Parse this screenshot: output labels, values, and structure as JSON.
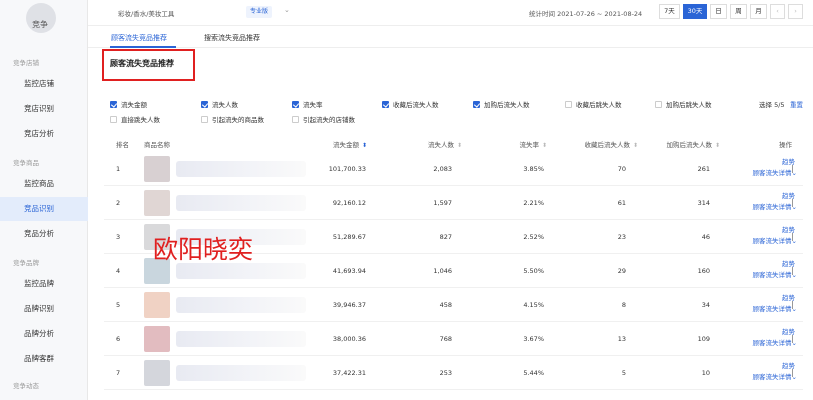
{
  "sidebar": {
    "logo_text": "竞争",
    "groups": [
      {
        "label": "竞争店铺",
        "items": [
          "监控店铺",
          "竞店识别",
          "竞店分析"
        ]
      },
      {
        "label": "竞争商品",
        "items": [
          "监控商品",
          "竞品识别",
          "竞品分析"
        ]
      },
      {
        "label": "竞争品牌",
        "items": [
          "监控品牌",
          "品牌识别",
          "品牌分析",
          "品牌客群"
        ]
      },
      {
        "label": "竞争动态",
        "items": []
      }
    ],
    "active_item": "竞品识别"
  },
  "topbar": {
    "breadcrumb": "彩妆/香水/美妆工具",
    "badge": "专业版",
    "stat_time": "统计时间 2021-07-26 ~ 2021-08-24",
    "range_buttons": [
      "7天",
      "30天",
      "日",
      "周",
      "月"
    ],
    "active_range": "30天"
  },
  "tabs": [
    "顾客流失竞品推荐",
    "搜索流失竞品推荐"
  ],
  "active_tab": "顾客流失竞品推荐",
  "section_title": "顾客流失竞品推荐",
  "filters": [
    {
      "label": "流失金额",
      "checked": true
    },
    {
      "label": "流失人数",
      "checked": true
    },
    {
      "label": "流失率",
      "checked": true
    },
    {
      "label": "收藏后流失人数",
      "checked": true
    },
    {
      "label": "加购后流失人数",
      "checked": true
    },
    {
      "label": "收藏后跳失人数",
      "checked": false
    },
    {
      "label": "加购后跳失人数",
      "checked": false
    },
    {
      "label": "直接跳失人数",
      "checked": false
    },
    {
      "label": "引起流失的商品数",
      "checked": false
    },
    {
      "label": "引起流失的店铺数",
      "checked": false
    }
  ],
  "selection": {
    "count_text": "选择 5/5",
    "reset_label": "重置"
  },
  "table": {
    "headers": [
      "排名",
      "商品名称",
      "流失金额",
      "流失人数",
      "流失率",
      "收藏后流失人数",
      "加购后流失人数",
      "操作"
    ],
    "op_trend": "趋势",
    "op_detail": "顾客流失详情",
    "rows": [
      {
        "rank": "1",
        "amount": "101,700.33",
        "people": "2,083",
        "rate": "3.85%",
        "fav": "70",
        "cart": "261",
        "thumb": "#d8d0d2"
      },
      {
        "rank": "2",
        "amount": "92,160.12",
        "people": "1,597",
        "rate": "2.21%",
        "fav": "61",
        "cart": "314",
        "thumb": "#e0d6d4"
      },
      {
        "rank": "3",
        "amount": "51,289.67",
        "people": "827",
        "rate": "2.52%",
        "fav": "23",
        "cart": "46",
        "thumb": "#d9d9db"
      },
      {
        "rank": "4",
        "amount": "41,693.94",
        "people": "1,046",
        "rate": "5.50%",
        "fav": "29",
        "cart": "160",
        "thumb": "#c9d6de"
      },
      {
        "rank": "5",
        "amount": "39,946.37",
        "people": "458",
        "rate": "4.15%",
        "fav": "8",
        "cart": "34",
        "thumb": "#f0d2c4"
      },
      {
        "rank": "6",
        "amount": "38,000.36",
        "people": "768",
        "rate": "3.67%",
        "fav": "13",
        "cart": "109",
        "thumb": "#e2bcc0"
      },
      {
        "rank": "7",
        "amount": "37,422.31",
        "people": "253",
        "rate": "5.44%",
        "fav": "5",
        "cart": "10",
        "thumb": "#d4d6dc"
      }
    ]
  },
  "watermark": "欧阳晓奕",
  "colors": {
    "accent": "#2a64d6",
    "highlight_box": "#e02020"
  }
}
